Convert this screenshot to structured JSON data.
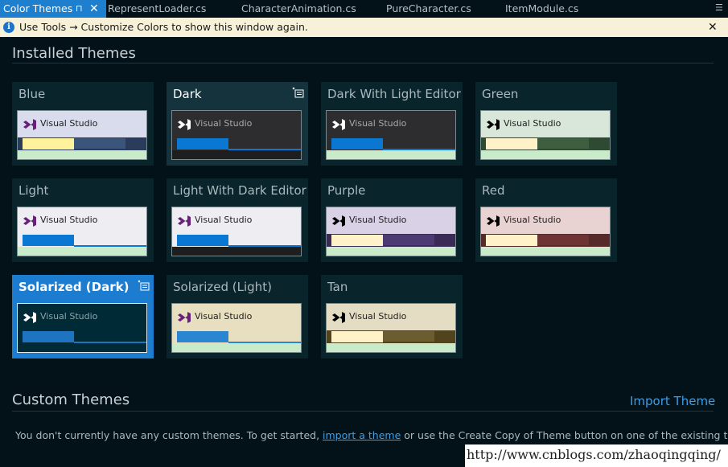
{
  "tabs": {
    "active": {
      "label": "Color Themes",
      "pin_glyph": "⊓",
      "close_glyph": "✕"
    },
    "files": [
      "RepresentLoader.cs",
      "CharacterAnimation.cs",
      "PureCharacter.cs",
      "ItemModule.cs"
    ],
    "overflow_glyph": "☰"
  },
  "infobar": {
    "icon_glyph": "i",
    "message": "Use Tools → Customize Colors to show this window again.",
    "close_glyph": "✕"
  },
  "installed": {
    "title": "Installed Themes",
    "preview_text": "Visual Studio",
    "themes": [
      {
        "name": "Blue",
        "state": "normal",
        "colors": {
          "bg": "#d8dcec",
          "text": "#1e1e1e",
          "logo": "#68217a",
          "strip": "#2b3b5c",
          "b1": "#fff29d",
          "b2": "#3b5479",
          "line": "#2b3b5c",
          "bottom": "#c9ebc9"
        }
      },
      {
        "name": "Dark",
        "state": "hover",
        "colors": {
          "bg": "#2d2d30",
          "text": "#a9a9a9",
          "logo": "#ffffff",
          "strip": "#2d2d30",
          "b1": "#0a78d2",
          "b2": "#2d2d30",
          "line": "#0a78d2",
          "bottom": "#1e1e1e"
        }
      },
      {
        "name": "Dark With Light Editor",
        "state": "normal",
        "colors": {
          "bg": "#2d2d30",
          "text": "#a9a9a9",
          "logo": "#ffffff",
          "strip": "#2d2d30",
          "b1": "#0a78d2",
          "b2": "#2d2d30",
          "line": "#0a78d2",
          "bottom": "#c9ebc9"
        }
      },
      {
        "name": "Green",
        "state": "normal",
        "colors": {
          "bg": "#d9e6da",
          "text": "#1e1e1e",
          "logo": "#000000",
          "strip": "#2f4a32",
          "b1": "#fff2c8",
          "b2": "#3d5f40",
          "line": "#2f4a32",
          "bottom": "#c9ebc9"
        }
      },
      {
        "name": "Light",
        "state": "normal",
        "colors": {
          "bg": "#eeeef2",
          "text": "#1e1e1e",
          "logo": "#68217a",
          "strip": "#eeeef2",
          "b1": "#0a78d2",
          "b2": "#eeeef2",
          "line": "#0a78d2",
          "bottom": "#c9ebc9"
        }
      },
      {
        "name": "Light With Dark Editor",
        "state": "normal",
        "colors": {
          "bg": "#eeeef2",
          "text": "#1e1e1e",
          "logo": "#68217a",
          "strip": "#eeeef2",
          "b1": "#0a78d2",
          "b2": "#eeeef2",
          "line": "#0a78d2",
          "bottom": "#1e1e1e"
        }
      },
      {
        "name": "Purple",
        "state": "normal",
        "colors": {
          "bg": "#d9d1e6",
          "text": "#1e1e1e",
          "logo": "#000000",
          "strip": "#3a2a56",
          "b1": "#fff2c8",
          "b2": "#4c3a72",
          "line": "#3a2a56",
          "bottom": "#c9ebc9"
        }
      },
      {
        "name": "Red",
        "state": "normal",
        "colors": {
          "bg": "#e9d2d2",
          "text": "#1e1e1e",
          "logo": "#000000",
          "strip": "#572a2a",
          "b1": "#fff2c8",
          "b2": "#6e3434",
          "line": "#572a2a",
          "bottom": "#c9ebc9"
        }
      },
      {
        "name": "Solarized (Dark)",
        "state": "selected",
        "colors": {
          "bg": "#002b36",
          "text": "#8fa3a7",
          "logo": "#ffffff",
          "strip": "#002b36",
          "b1": "#1e74c0",
          "b2": "#002b36",
          "line": "#1e74c0",
          "bottom": "#002b36"
        }
      },
      {
        "name": "Solarized (Light)",
        "state": "normal",
        "colors": {
          "bg": "#e8dfc1",
          "text": "#1e1e1e",
          "logo": "#68217a",
          "strip": "#e8dfc1",
          "b1": "#2a86d0",
          "b2": "#e8dfc1",
          "line": "#2a86d0",
          "bottom": "#c9ebc9"
        }
      },
      {
        "name": "Tan",
        "state": "normal",
        "colors": {
          "bg": "#e5dcc4",
          "text": "#1e1e1e",
          "logo": "#000000",
          "strip": "#51441d",
          "b1": "#fff2c8",
          "b2": "#6b5d30",
          "line": "#51441d",
          "bottom": "#c9ebc9"
        }
      }
    ]
  },
  "custom": {
    "title": "Custom Themes",
    "import_label": "Import Theme",
    "msg_before": "You don't currently have any custom themes. To get started, ",
    "msg_link": "import a theme",
    "msg_after": " or use the Create Copy of Theme button on one of the existing themes."
  },
  "watermark": "http://www.cnblogs.com/zhaoqingqing/"
}
